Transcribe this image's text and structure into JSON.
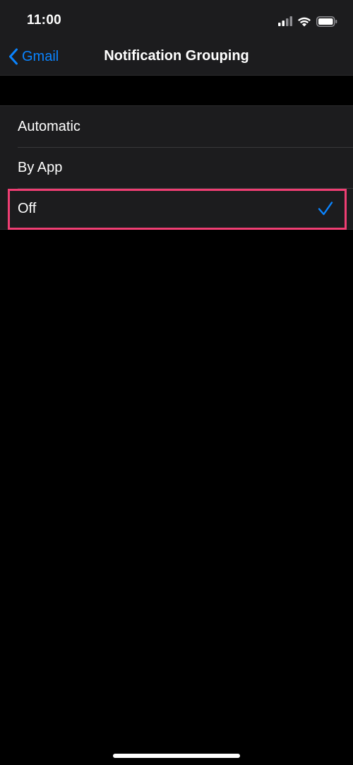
{
  "status_bar": {
    "time": "11:00"
  },
  "nav": {
    "back_label": "Gmail",
    "title": "Notification Grouping"
  },
  "options": [
    {
      "label": "Automatic",
      "selected": false
    },
    {
      "label": "By App",
      "selected": false
    },
    {
      "label": "Off",
      "selected": true
    }
  ],
  "icons": {
    "back": "chevron-left-icon",
    "selected": "checkmark-icon",
    "signal": "cellular-signal-icon",
    "wifi": "wifi-icon",
    "battery": "battery-icon"
  },
  "colors": {
    "accent": "#0a84ff",
    "highlight": "#ef3e73",
    "background": "#000000",
    "surface": "#1c1c1e"
  }
}
